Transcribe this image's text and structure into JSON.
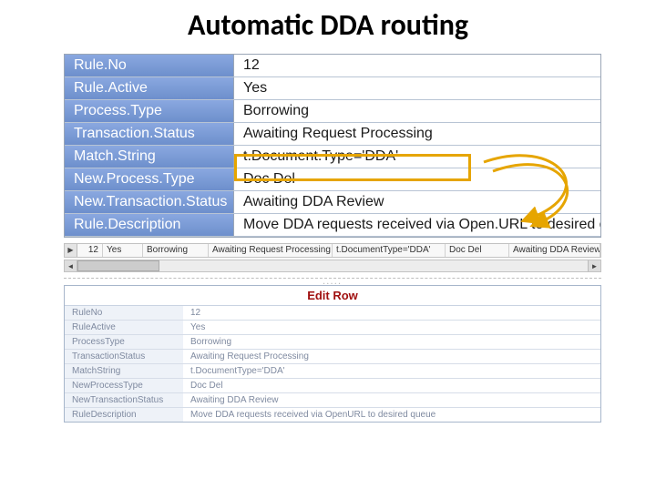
{
  "title": "Automatic DDA routing",
  "main_table": {
    "rows": [
      {
        "label": "Rule.No",
        "value": "12"
      },
      {
        "label": "Rule.Active",
        "value": "Yes"
      },
      {
        "label": "Process.Type",
        "value": "Borrowing"
      },
      {
        "label": "Transaction.Status",
        "value": "Awaiting Request Processing"
      },
      {
        "label": "Match.String",
        "value": "t.Document.Type='DDA'"
      },
      {
        "label": "New.Process.Type",
        "value": "Doc Del"
      },
      {
        "label": "New.Transaction.Status",
        "value": "Awaiting DDA Review"
      },
      {
        "label": "Rule.Description",
        "value": "Move DDA requests received via Open.URL to desired queue"
      }
    ]
  },
  "highlight_box": {
    "row_index": 4
  },
  "grid_row": {
    "cells": [
      "12",
      "Yes",
      "Borrowing",
      "Awaiting Request Processing",
      "t.DocumentType='DDA'",
      "Doc Del",
      "Awaiting DDA Review"
    ]
  },
  "edit_panel": {
    "header": "Edit Row",
    "rows": [
      {
        "label": "RuleNo",
        "value": "12"
      },
      {
        "label": "RuleActive",
        "value": "Yes"
      },
      {
        "label": "ProcessType",
        "value": "Borrowing"
      },
      {
        "label": "TransactionStatus",
        "value": "Awaiting Request Processing"
      },
      {
        "label": "MatchString",
        "value": "t.DocumentType='DDA'"
      },
      {
        "label": "NewProcessType",
        "value": "Doc Del"
      },
      {
        "label": "NewTransactionStatus",
        "value": "Awaiting DDA Review"
      },
      {
        "label": "RuleDescription",
        "value": "Move DDA requests received via OpenURL to desired queue"
      }
    ]
  }
}
